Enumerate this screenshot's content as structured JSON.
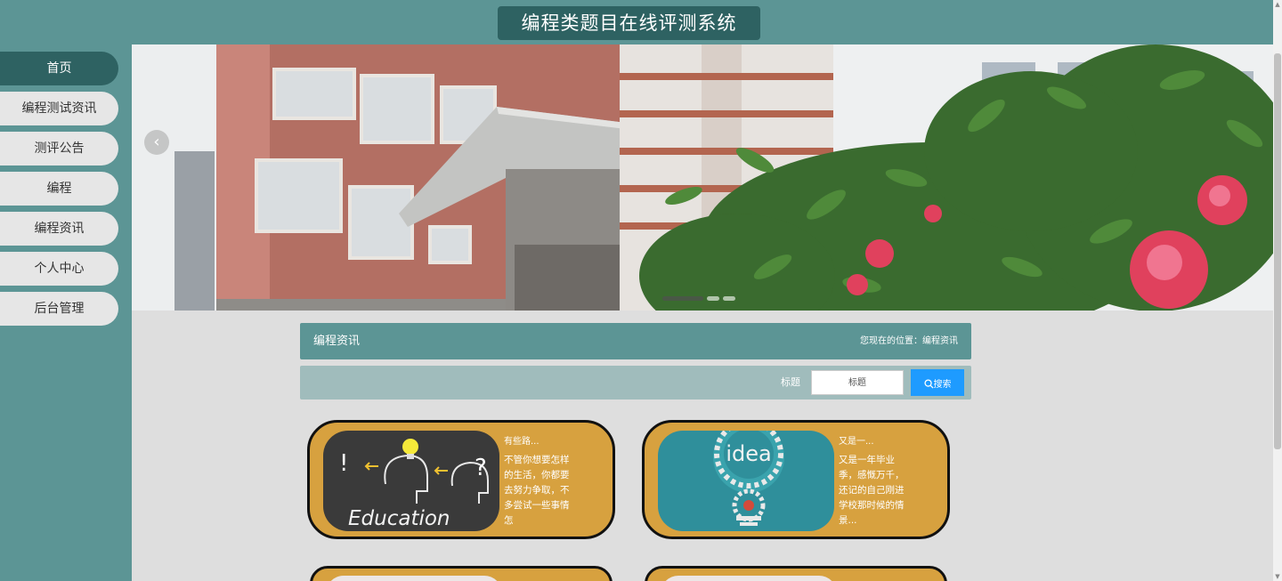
{
  "header": {
    "title": "编程类题目在线评测系统"
  },
  "sidebar": {
    "items": [
      {
        "label": "首页"
      },
      {
        "label": "编程测试资讯"
      },
      {
        "label": "测评公告"
      },
      {
        "label": "编程"
      },
      {
        "label": "编程资讯"
      },
      {
        "label": "个人中心"
      },
      {
        "label": "后台管理"
      }
    ],
    "active_index": 0
  },
  "carousel": {
    "prev_icon": "chevron-left-icon",
    "slide_count": 3,
    "active_slide": 0
  },
  "section": {
    "title": "编程资讯",
    "breadcrumb": "您现在的位置：编程资讯"
  },
  "search": {
    "label": "标题",
    "placeholder": "标题",
    "button_label": "搜索",
    "button_icon": "search-icon"
  },
  "cards": [
    {
      "title": "有些路...",
      "summary": "不管你想要怎样的生活，你都要去努力争取，不多尝试一些事情怎",
      "image_text": "Education"
    },
    {
      "title": "又是一...",
      "summary": "又是一年毕业季，感慨万千，还记的自己刚进学校那时候的情景...",
      "image_text": "idea"
    }
  ],
  "colors": {
    "accent": "#5c9595",
    "accent_dark": "#2e6262",
    "card_bg": "#d7a13f",
    "search_button": "#1e9bff"
  }
}
